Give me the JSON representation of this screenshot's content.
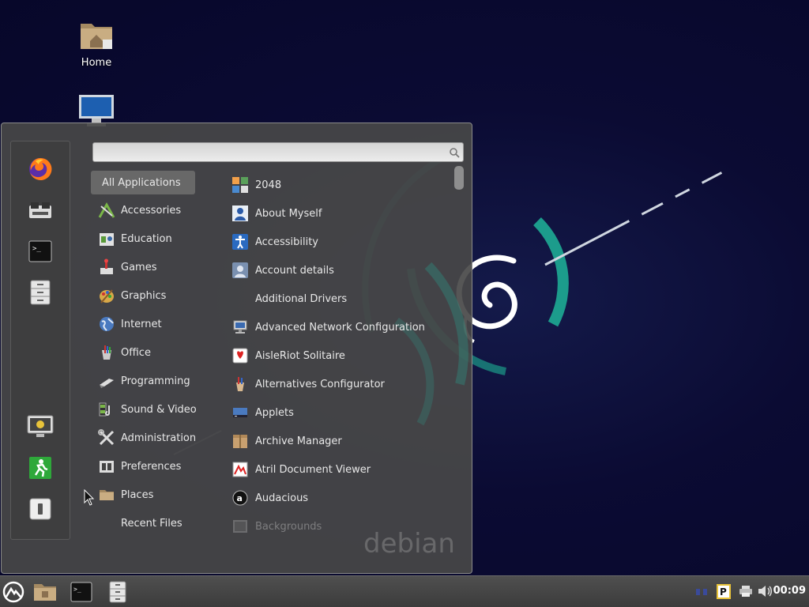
{
  "desktop": {
    "icons": [
      {
        "label": "Home",
        "icon": "folder-home-icon"
      },
      {
        "label": "",
        "icon": "computer-icon"
      }
    ]
  },
  "menu": {
    "search": {
      "value": "",
      "placeholder": ""
    },
    "favorites": [
      {
        "name": "firefox",
        "icon": "firefox-icon"
      },
      {
        "name": "software-manager",
        "icon": "software-manager-icon"
      },
      {
        "name": "terminal",
        "icon": "terminal-icon"
      },
      {
        "name": "file-manager",
        "icon": "file-cabinet-icon"
      }
    ],
    "session": [
      {
        "name": "lock-screen",
        "icon": "lock-screen-icon"
      },
      {
        "name": "logout",
        "icon": "exit-icon"
      },
      {
        "name": "shutdown",
        "icon": "power-icon"
      }
    ],
    "categories": [
      {
        "label": "All Applications",
        "selected": true
      },
      {
        "label": "Accessories",
        "icon": "accessories-icon"
      },
      {
        "label": "Education",
        "icon": "education-icon"
      },
      {
        "label": "Games",
        "icon": "games-icon"
      },
      {
        "label": "Graphics",
        "icon": "graphics-icon"
      },
      {
        "label": "Internet",
        "icon": "internet-globe-icon"
      },
      {
        "label": "Office",
        "icon": "office-icon"
      },
      {
        "label": "Programming",
        "icon": "programming-icon"
      },
      {
        "label": "Sound & Video",
        "icon": "sound-video-icon"
      },
      {
        "label": "Administration",
        "icon": "administration-icon"
      },
      {
        "label": "Preferences",
        "icon": "preferences-icon"
      },
      {
        "label": "Places",
        "icon": "folder-icon"
      },
      {
        "label": "Recent Files",
        "icon": ""
      }
    ],
    "apps": [
      {
        "label": "2048",
        "icon": "2048-icon"
      },
      {
        "label": "About Myself",
        "icon": "user-icon"
      },
      {
        "label": "Accessibility",
        "icon": "accessibility-icon"
      },
      {
        "label": "Account details",
        "icon": "account-icon"
      },
      {
        "label": "Additional Drivers",
        "icon": ""
      },
      {
        "label": "Advanced Network Configuration",
        "icon": "network-icon"
      },
      {
        "label": "AisleRiot Solitaire",
        "icon": "cards-icon"
      },
      {
        "label": "Alternatives Configurator",
        "icon": "alternatives-icon"
      },
      {
        "label": "Applets",
        "icon": "applets-icon"
      },
      {
        "label": "Archive Manager",
        "icon": "archive-icon"
      },
      {
        "label": "Atril Document Viewer",
        "icon": "document-viewer-icon"
      },
      {
        "label": "Audacious",
        "icon": "audacious-icon"
      },
      {
        "label": "Backgrounds",
        "icon": "backgrounds-icon"
      }
    ],
    "watermark": "debian"
  },
  "taskbar": {
    "launchers": [
      {
        "name": "menu",
        "icon": "cinnamon-menu-icon"
      },
      {
        "name": "files",
        "icon": "folder-icon"
      },
      {
        "name": "terminal",
        "icon": "terminal-icon"
      },
      {
        "name": "file-manager",
        "icon": "file-cabinet-icon"
      }
    ],
    "tray": [
      {
        "name": "network",
        "icon": "network-icon"
      },
      {
        "name": "parcellite",
        "icon": "clipboard-icon"
      },
      {
        "name": "printer",
        "icon": "printer-icon"
      },
      {
        "name": "volume",
        "icon": "volume-icon"
      }
    ],
    "clock": "00:09"
  }
}
